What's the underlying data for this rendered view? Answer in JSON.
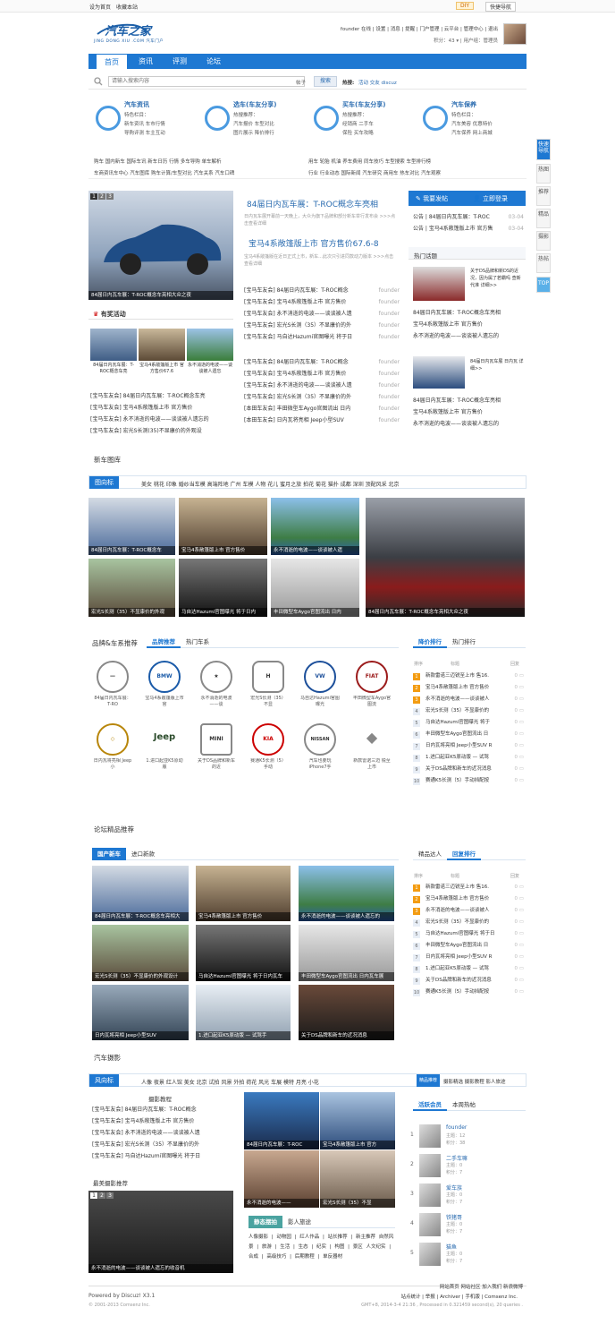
{
  "topbar": {
    "home": "设为首页",
    "fav": "收藏本站",
    "diy": "DIY",
    "quicknav": "快捷导航"
  },
  "header": {
    "logo_title": "汽车之家",
    "logo_sub": "JING DONG XIU .COM 汽车门户",
    "user_links": "founder 在线 | 设置 | 消息 | 提醒 | 门户管理 | 云平台 | 管理中心 | 退出",
    "user_stats": "积分：43 ▾ | 用户组：管理员"
  },
  "nav": [
    {
      "label": "首页"
    },
    {
      "label": "资讯"
    },
    {
      "label": "评测"
    },
    {
      "label": "论坛"
    }
  ],
  "search": {
    "placeholder": "请输入搜索内容",
    "scope": "帖子",
    "button": "搜索",
    "hot_label": "热搜:",
    "hot": "活动 交友 discuz"
  },
  "categories": [
    {
      "title": "汽车资讯",
      "l1": "特色栏目：",
      "l2": "新车资讯   车市行情",
      "l3": "导购评测   车主互动"
    },
    {
      "title": "选车(车友分享)",
      "l1": "热搜推荐：",
      "l2": "汽车报价   车型对比",
      "l3": "图片展示   降价排行"
    },
    {
      "title": "买车(车友分享)",
      "l1": "热搜推荐：",
      "l2": "经销商     二手车",
      "l3": "保险       买车攻略"
    },
    {
      "title": "汽车保养",
      "l1": "特色栏目：",
      "l2": "汽车美容   优惠特价",
      "l3": "汽车保养   网上商城"
    }
  ],
  "quicklinks": {
    "row1a": "购车  国内新车  国际车讯  新车日历  行情  多车导购  单车解析",
    "row1b": "用车  轮胎  机油  养车费用  同车技巧  车型搜索  车型排行榜",
    "row2a": "车商资讯车中心  汽车图库  购车计算/车型对比  汽车关系  汽车口碑",
    "row2b": "行业  行业动态  国际新闻  汽车研究  商用车  热车对比  汽车观察"
  },
  "hero": {
    "caption": "84届日内瓦车展：T-ROC概念车亮相大众之夜",
    "pages": [
      "1",
      "2",
      "3"
    ],
    "headline1": "84届日内瓦车展：T-ROC概念车亮相",
    "summary1": "日内瓦车展开幕前一天晚上，大众为旗下品牌和部分新车举行发布会 >>>点击查看详细",
    "headline2": "宝马4系敞篷版上市 官方售价67.6-8",
    "summary2": "宝马4系敞篷版在近日正式上市，新车...此次只引进同款动力版本 >>>点击查看详细"
  },
  "activities": {
    "title": "有奖活动",
    "items": [
      {
        "cap": "84届日内瓦车展：T-ROC概念车亮"
      },
      {
        "cap": "宝马4系敞篷版上市 官方售价67.6"
      },
      {
        "cap": "永不消逝的电波——谈谈被人遗忘"
      }
    ],
    "links": [
      "[宝马车友会] 84届日内瓦车展：T-ROC概念车亮",
      "[宝马车友会] 宝马4系敞篷版上市 官方售价",
      "[宝马车友会] 永不消逝的电波——谈谈被人遗忘的",
      "[宝马车友会] 宏光S长测(35)不显康价的外观设"
    ]
  },
  "midlist1": [
    {
      "t": "[宝马车友会] 84届日内瓦车展：T-ROC概念",
      "a": "founder"
    },
    {
      "t": "[宝马车友会] 宝马4系敞篷版上市 官方售价",
      "a": "founder"
    },
    {
      "t": "[宝马车友会] 永不消逝的电波——谈谈被人遗",
      "a": "founder"
    },
    {
      "t": "[宝马车友会] 宏光S长测（35）不显康价的外",
      "a": "founder"
    },
    {
      "t": "[宝马车友会] 马自达Hazumi官图曝光 将于日",
      "a": "founder"
    }
  ],
  "midlist2": [
    {
      "t": "[宝马车友会] 84届日内瓦车展：T-ROC概念",
      "a": "founder"
    },
    {
      "t": "[宝马车友会] 宝马4系敞篷版上市 官方售价",
      "a": "founder"
    },
    {
      "t": "[宝马车友会] 永不消逝的电波——谈谈被人遗",
      "a": "founder"
    },
    {
      "t": "[宝马车友会] 宏光S长测（35）不显康价的外",
      "a": "founder"
    },
    {
      "t": "[本田车友会] 丰田微型车Aygo官图流出 日内",
      "a": "founder"
    },
    {
      "t": "[本田车友会] 日内瓦将亮相 Jeep小型SUV",
      "a": "founder"
    }
  ],
  "right": {
    "post": "我要发帖",
    "login": "立即登录",
    "notices": [
      {
        "t": "公告 | 84届日内瓦车展：T-ROC",
        "d": "03-04"
      },
      {
        "t": "公告 | 宝马4系敞篷版上市 官方售",
        "d": "03-04"
      }
    ],
    "hot_title": "热门话题",
    "hot1": "关于DS品牌和新DS的近况，因为属了若霸吗 查新代准 详细>>",
    "hot2": "84届日内瓦车展 日内瓦 详细>>",
    "hotlist1": [
      "84届日内瓦车展：T-ROC概念车亮相",
      "宝马4系敞篷版上市 官方售价",
      "永不消逝的电波——谈谈被人遗忘的"
    ],
    "hotlist2": [
      "84届日内瓦车展：T-ROC概念车亮相",
      "宝马4系敞篷版上市 官方售价",
      "永不消逝的电波——谈谈被人遗忘的"
    ]
  },
  "gallery": {
    "title": "新车图库",
    "label": "图向标",
    "tags": "美女 桃花 印象 婚纱当车模 高端阵地 广州 车模 人物 花儿 蜜月之旅 拍花 菊花 猫扑 成都 深圳 顶配风采 北京",
    "caps": [
      "84届日内瓦车展：T-ROC概念车",
      "宝马4系敞篷版上市 官方售价",
      "永不消逝的电波——谈谈被人遗",
      "84届日内瓦车展：T-ROC概念车亮相大众之夜",
      "宏光S长测（35）不显康价的外观",
      "马自达Hazumi官图曝光 将于日内",
      "丰田微型车Aygo官图流出 日内"
    ]
  },
  "brands": {
    "title": "品牌&车系推荐",
    "tab1": "品牌推荐",
    "tab2": "热门车系",
    "items": [
      {
        "logo": "—",
        "t": "84届日内瓦车展：T-RO"
      },
      {
        "logo": "BMW",
        "t": "宝马4系敞篷版上市 官"
      },
      {
        "logo": "★",
        "t": "永不消逝的电波——谈"
      },
      {
        "logo": "H",
        "t": "宏光S长测（35）不显"
      },
      {
        "logo": "VW",
        "t": "马自达Hazumi官图曝光"
      },
      {
        "logo": "FIAT",
        "t": "丰田微型车Aygo官图流"
      },
      {
        "logo": "◇",
        "t": "日内瓦将亮相 Jeep小"
      },
      {
        "logo": "Jeep",
        "t": "1.进口起亚K5原动版"
      },
      {
        "logo": "MINI",
        "t": "关于DS品牌和新车的近"
      },
      {
        "logo": "KIA",
        "t": "赛通K5长测（5）手动"
      },
      {
        "logo": "NISSAN",
        "t": "汽车也要玩 iPhone7手"
      },
      {
        "logo": "◆",
        "t": "新款雷诺三迈 锐至上市"
      }
    ]
  },
  "rank1": {
    "tab1": "降价排行",
    "tab2": "热门排行",
    "h1": "排序",
    "h2": "标题",
    "h3": "回复",
    "items": [
      "新款雷诺三迈锐至上市 售16.",
      "宝马4系敞篷版上市 官方售价",
      "永不消逝的电波——谈谈被人",
      "宏光S长测（35）不显康价的",
      "马自达Hazumi官图曝光 将于",
      "丰田微型车Aygo官图流出 日",
      "日内瓦将亮相 Jeep小型SUV R",
      "1.进口起亚K5原动版 — 试驾",
      "关于DS品牌和新车的近况消息",
      "赛通K5长测（5）手动挡配按"
    ]
  },
  "forum": {
    "title": "论坛精品推荐",
    "tab1": "国产新车",
    "tab2": "进口新款",
    "caps": [
      "84届日内瓦车展：T-ROC概念车亮相大",
      "宝马4系敞篷版上市 官方售价",
      "永不消逝的电波——谈谈被人遗忘的",
      "宏光S长测（35）不显康价的外观设计",
      "马自达Hazumi官图曝光 将于日内瓦车",
      "丰田微型车Aygo官图流出 日内瓦车展",
      "日内瓦将亮相 Jeep小型SUV",
      "1.进口起亚K5原动版 — 试驾手",
      "关于DS品牌和新车的近况消息"
    ]
  },
  "rank2": {
    "tab1": "精品达人",
    "tab2": "回复排行",
    "h1": "排序",
    "h2": "标题",
    "h3": "回复",
    "items": [
      "新款雷诺三迈锐至上市 售16.",
      "宝马4系敞篷版上市 官方售价",
      "永不消逝的电波——谈谈被人",
      "宏光S长测（35）不显康价的",
      "马自达Hazumi官图曝光 将于日",
      "丰田微型车Aygo官图流出 日",
      "日内瓦将亮相 Jeep小型SUV R",
      "1.进口起亚K5原动版 — 试驾",
      "关于DS品牌和新车的近况消息",
      "赛通K5长测（5）手动挡配按"
    ]
  },
  "photo": {
    "title": "汽车摄影",
    "label": "风向标",
    "tags": "人像 夜景 红人馆 美女 北京 试拍 风景 外拍 荷花 风光 车展 模特 月亮 小花",
    "btn": "精品推荐",
    "tags2": "摄影精选 摄影教程 影人旅途",
    "tut_title": "摄影教程",
    "tut": [
      "[宝马车友会] 84届日内瓦车展：T-ROC概念",
      "[宝马车友会] 宝马4系敞篷版上市 官方售价",
      "[宝马车友会] 永不消逝的电波——谈谈被人遗",
      "[宝马车友会] 宏光S长测（35）不显康价的外",
      "[宝马车友会] 马自达Hazumi官图曝光 将于日"
    ],
    "best": "最美摄影推荐",
    "best_cap": "永不消逝的电波——谈谈被人遗忘的收音机",
    "caps": [
      "84届日内瓦车展：T-ROC",
      "宝马4系敞篷版上市 官方",
      "永不消逝的电波——",
      "宏光S长测（35）不显"
    ],
    "t1": "静态摆拍",
    "t2": "影人旅途",
    "kw": [
      "人像摄影",
      "动物园",
      "红人作品",
      "站长推荐",
      "新主推荐",
      "自然风景",
      "旅游",
      "生活",
      "生态",
      "纪实",
      "构图",
      "景区",
      "人文纪实",
      "合成",
      "高级技巧",
      "后期教程",
      "单反器材"
    ],
    "m_tab1": "活跃会员",
    "m_tab2": "本周热帖",
    "members": [
      {
        "n": "founder",
        "s1": "主题：12",
        "s2": "积分：38",
        "r": "1"
      },
      {
        "n": "二手车嘛",
        "s1": "主题：0",
        "s2": "积分：7",
        "r": "2"
      },
      {
        "n": "爱车族",
        "s1": "主题：0",
        "s2": "积分：7",
        "r": "3"
      },
      {
        "n": "铁猪哥",
        "s1": "主题：0",
        "s2": "积分：7",
        "r": "4"
      },
      {
        "n": "猫鱼",
        "s1": "主题：0",
        "s2": "积分：7",
        "r": "5"
      }
    ]
  },
  "footer": {
    "powered": "Powered by Discuz! X3.1",
    "copy": "© 2001-2013 Comsenz Inc.",
    "links": "网站首页  网站社区  加入我们  新浪微博",
    "links2": "站点统计 | 举报 | Archiver | 手机版 | Comsenz Inc.",
    "time": "GMT+8, 2014-3-4 21:36 , Processed in 0.321459 second(s), 20 queries ."
  },
  "side": [
    "快速导航",
    "热图",
    "推荐",
    "精品",
    "摄影",
    "热帖",
    "TOP"
  ]
}
